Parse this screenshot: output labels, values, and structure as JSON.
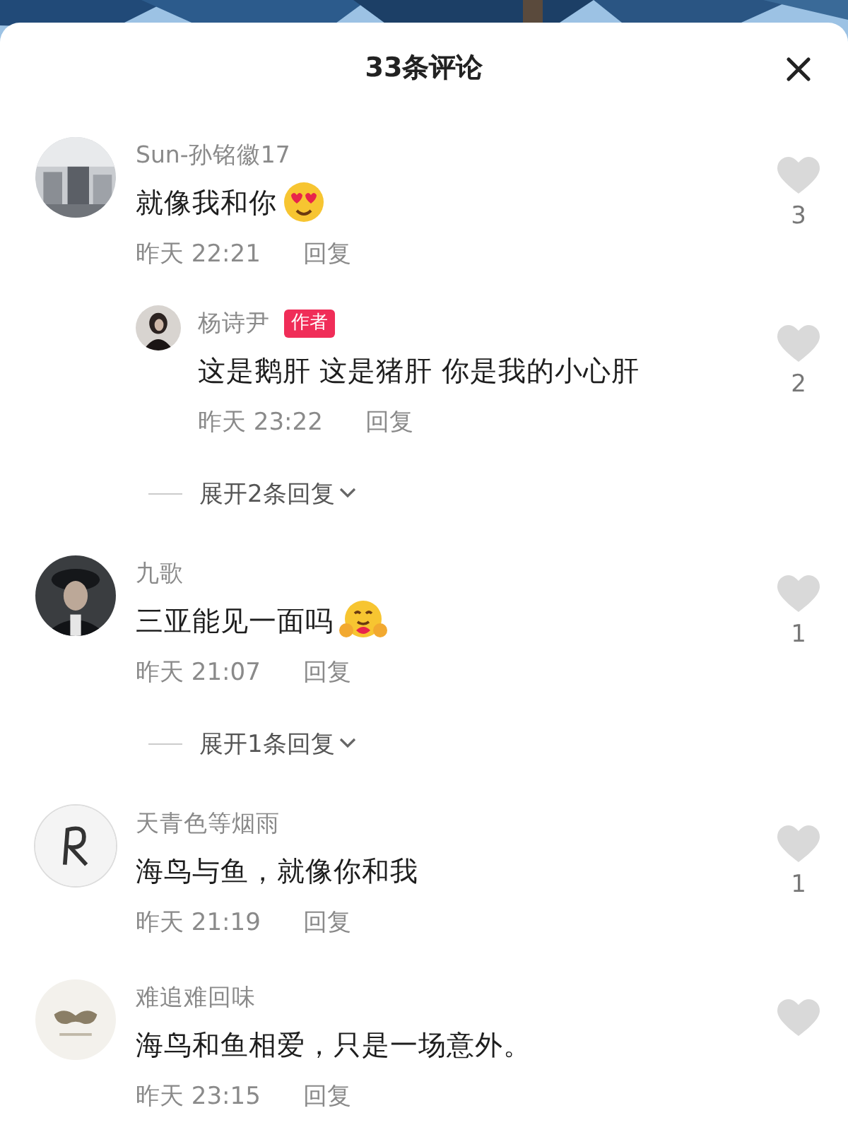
{
  "header": {
    "title": "33条评论"
  },
  "comments": [
    {
      "avatar": {
        "kind": "light"
      },
      "name": "Sun-孙铭徽17",
      "text": "就像我和你",
      "emoji": {
        "kind": "heart-eyes"
      },
      "time": "昨天 22:21",
      "reply_label": "回复",
      "likes": "3",
      "replies": [
        {
          "avatar": {
            "kind": "dark"
          },
          "name": "杨诗尹",
          "badge": "作者",
          "text": "这是鹅肝 这是猪肝 你是我的小心肝",
          "time": "昨天 23:22",
          "reply_label": "回复",
          "likes": "2"
        }
      ],
      "expand": "展开2条回复"
    },
    {
      "avatar": {
        "kind": "uniform"
      },
      "name": "九歌",
      "text": "三亚能见一面吗",
      "emoji": {
        "kind": "hug"
      },
      "time": "昨天 21:07",
      "reply_label": "回复",
      "likes": "1",
      "expand": "展开1条回复"
    },
    {
      "avatar": {
        "kind": "script"
      },
      "name": "天青色等烟雨",
      "text": "海鸟与鱼，就像你和我",
      "time": "昨天 21:19",
      "reply_label": "回复",
      "likes": "1"
    },
    {
      "avatar": {
        "kind": "mask"
      },
      "name": "难追难回味",
      "text": "海鸟和鱼相爱，只是一场意外。",
      "time": "昨天 23:15",
      "reply_label": "回复"
    }
  ]
}
